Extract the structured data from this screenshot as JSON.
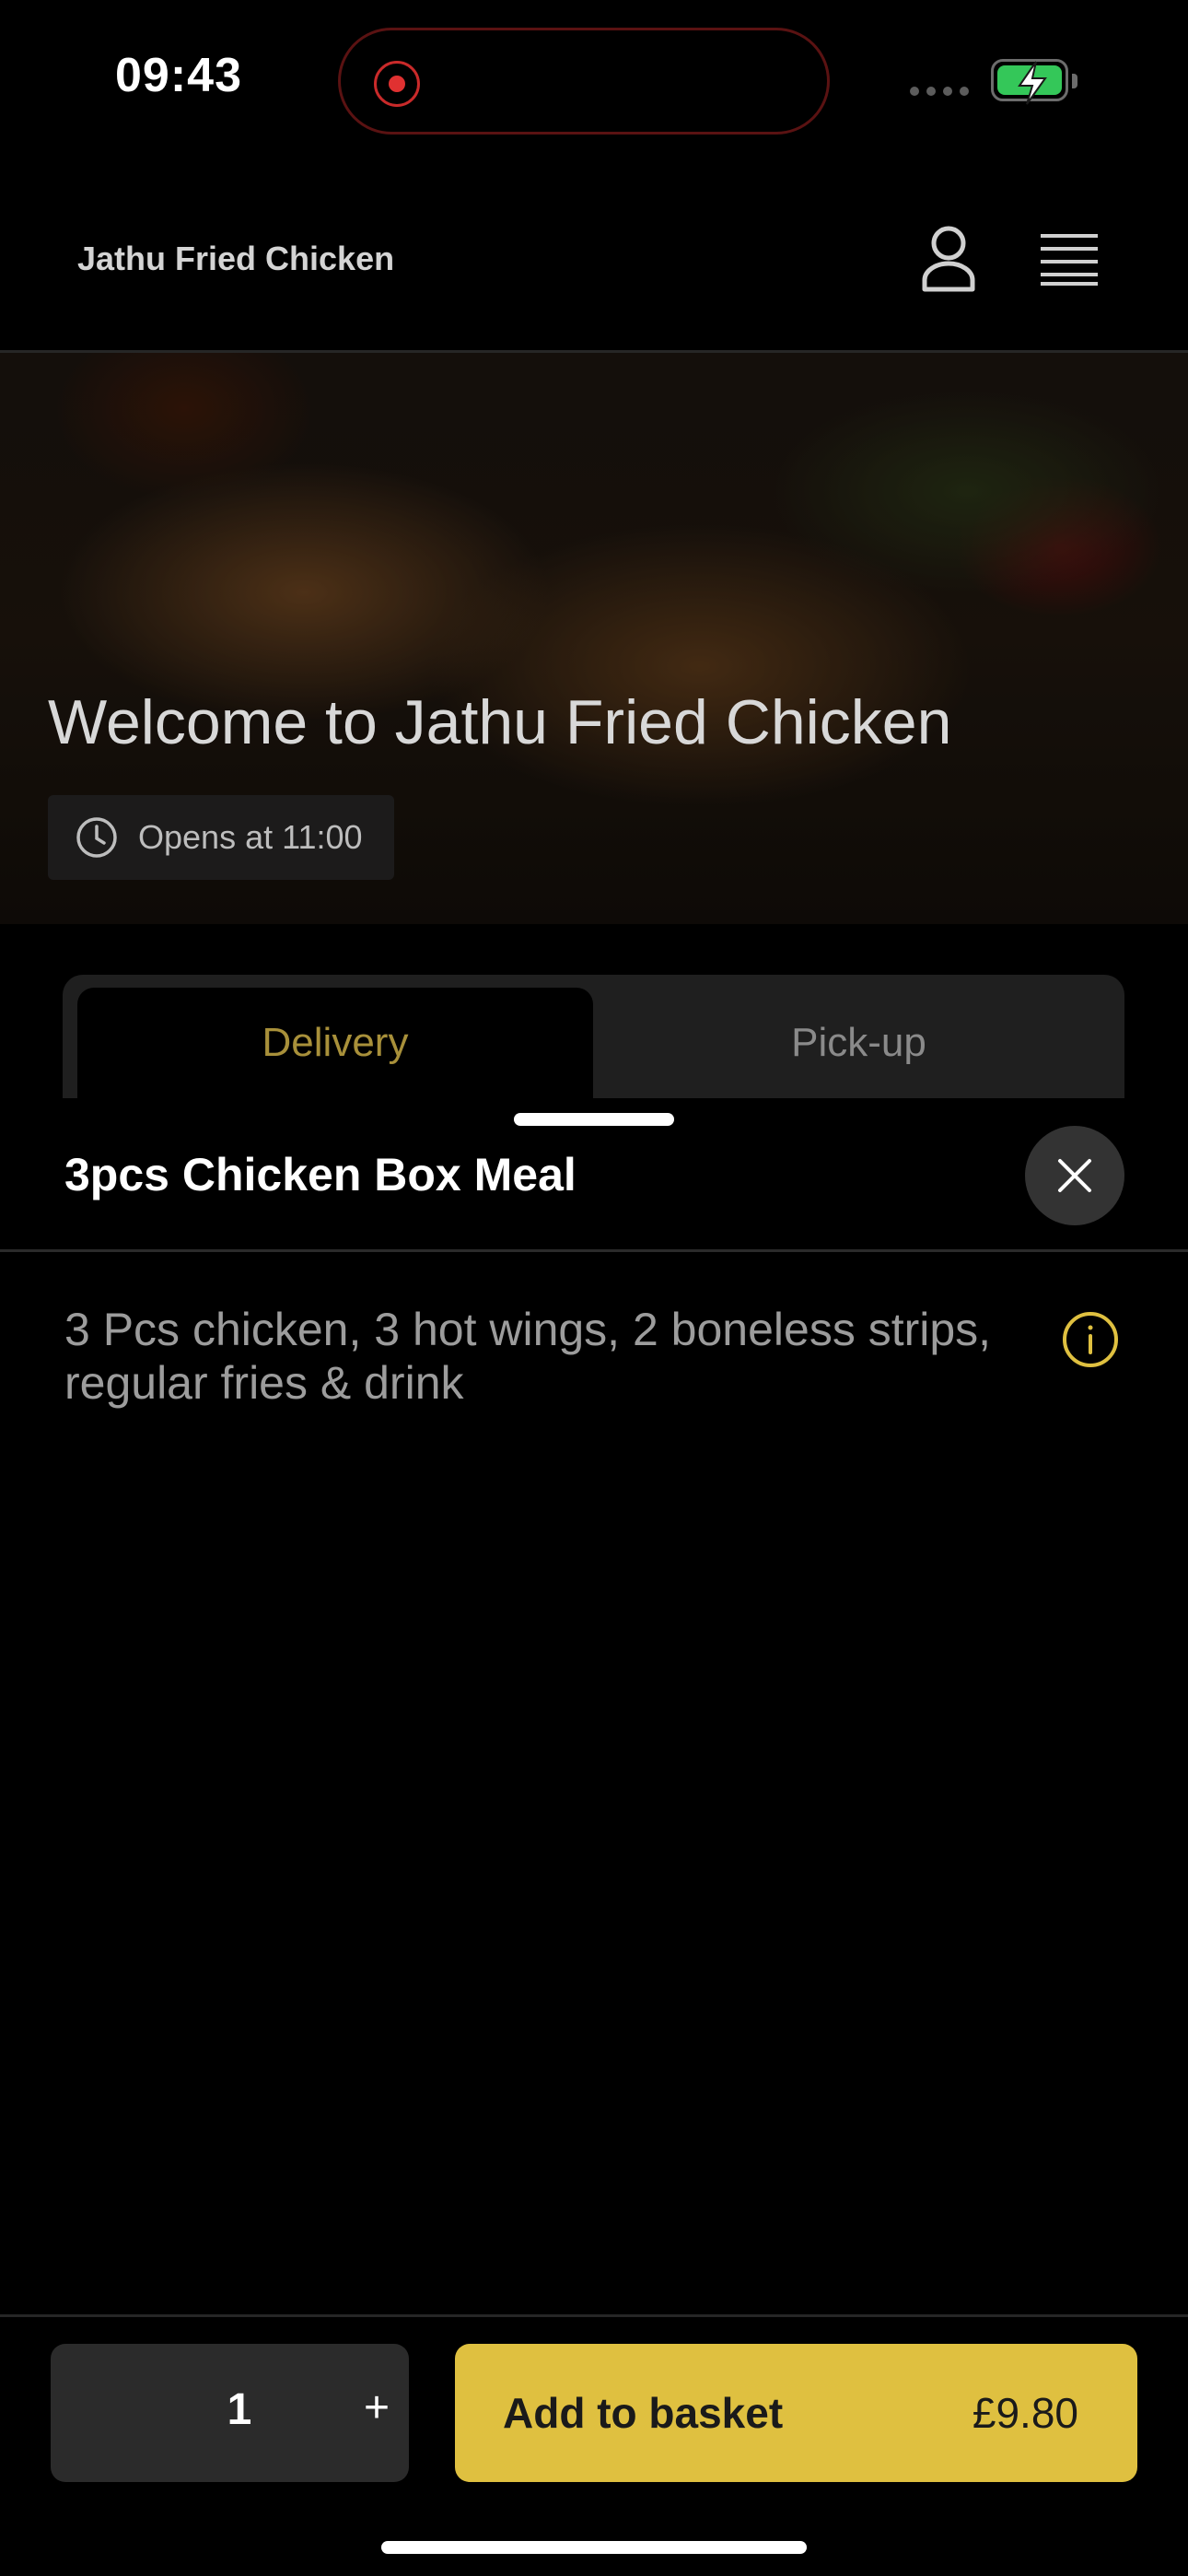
{
  "status_bar": {
    "time": "09:43",
    "battery_level": "charging",
    "battery_color": "#34c759",
    "recording_color": "#e03131"
  },
  "header": {
    "brand": "Jathu Fried Chicken",
    "icons": [
      "user-icon",
      "menu-icon"
    ]
  },
  "hero": {
    "title": "Welcome to Jathu Fried Chicken",
    "hours_text": "Opens at 11:00",
    "hours_icon": "clock-icon"
  },
  "tabs": [
    {
      "label": "Delivery",
      "active": true
    },
    {
      "label": "Pick-up",
      "active": false
    }
  ],
  "item": {
    "title": "3pcs Chicken Box Meal",
    "description": "3 Pcs chicken, 3 hot wings, 2 boneless strips, regular fries & drink",
    "close_icon": "close-icon",
    "info_icon": "info-icon"
  },
  "footer": {
    "quantity": "1",
    "plus_label": "+",
    "add_label": "Add to basket",
    "price": "£9.80"
  },
  "colors": {
    "accent": "#dfc040",
    "active_tab_text": "#a8903a",
    "background": "#000000"
  }
}
